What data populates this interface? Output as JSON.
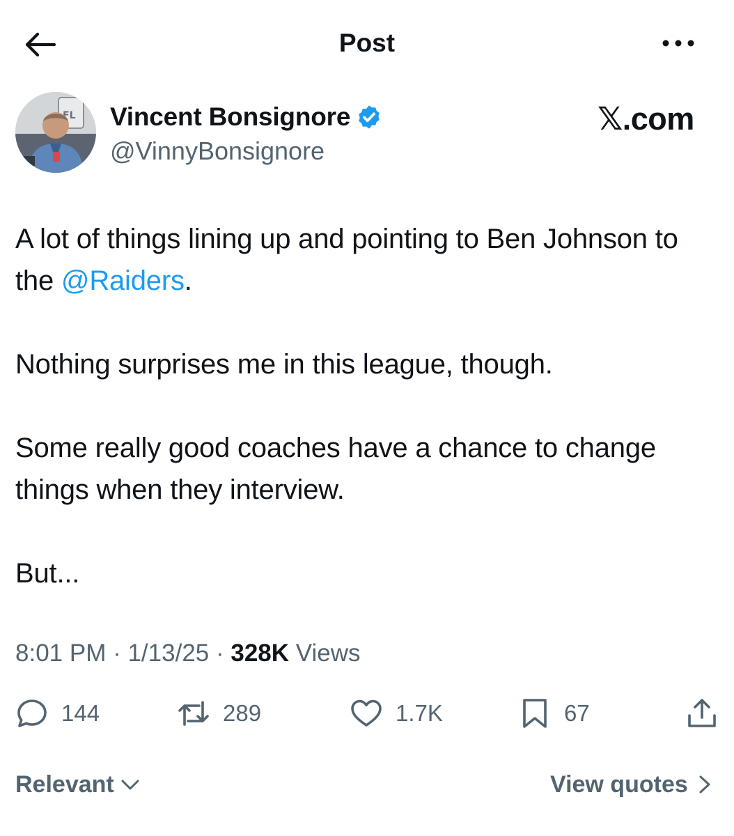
{
  "header": {
    "title": "Post"
  },
  "author": {
    "name": "Vincent Bonsignore",
    "handle": "@VinnyBonsignore",
    "verified": true,
    "avatar_icon": "avatar-photo"
  },
  "watermark": "𝕏.com",
  "post": {
    "p1_before": "A lot of things lining up and pointing to Ben Johnson to the ",
    "p1_mention": "@Raiders",
    "p1_after": ".",
    "p2": "Nothing surprises me in this league, though.",
    "p3": "Some really good coaches have a chance to change things when they interview.",
    "p4": "But..."
  },
  "meta": {
    "time": "8:01 PM",
    "sep1": " · ",
    "date": "1/13/25",
    "sep2": " · ",
    "views_count": "328K",
    "views_label": " Views"
  },
  "actions": {
    "replies": "144",
    "reposts": "289",
    "likes": "1.7K",
    "bookmarks": "67"
  },
  "footer": {
    "sort_label": "Relevant",
    "quotes_label": "View quotes"
  },
  "colors": {
    "accent": "#1d9bf0",
    "secondary_text": "#536471",
    "primary_text": "#0f1419"
  }
}
